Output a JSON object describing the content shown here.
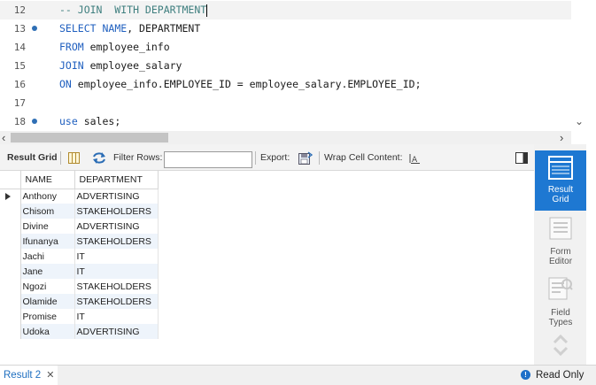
{
  "editor": {
    "lines": [
      {
        "num": "12",
        "marker": false,
        "parts": [
          {
            "t": "-- JOIN  WITH DEPARTMENT",
            "c": "cmt"
          }
        ]
      },
      {
        "num": "13",
        "marker": true,
        "parts": [
          {
            "t": "SELECT",
            "c": "kw"
          },
          {
            "t": " ",
            "c": "txt"
          },
          {
            "t": "NAME",
            "c": "kw"
          },
          {
            "t": ", DEPARTMENT",
            "c": "txt"
          }
        ]
      },
      {
        "num": "14",
        "marker": false,
        "parts": [
          {
            "t": "FROM",
            "c": "kw"
          },
          {
            "t": " employee_info",
            "c": "txt"
          }
        ]
      },
      {
        "num": "15",
        "marker": false,
        "parts": [
          {
            "t": "JOIN",
            "c": "kw"
          },
          {
            "t": " employee_salary",
            "c": "txt"
          }
        ]
      },
      {
        "num": "16",
        "marker": false,
        "parts": [
          {
            "t": "ON",
            "c": "kw"
          },
          {
            "t": " employee_info.EMPLOYEE_ID = employee_salary.EMPLOYEE_ID;",
            "c": "txt"
          }
        ]
      },
      {
        "num": "17",
        "marker": false,
        "parts": []
      },
      {
        "num": "18",
        "marker": true,
        "parts": [
          {
            "t": "use",
            "c": "kw"
          },
          {
            "t": " sales;",
            "c": "txt"
          }
        ]
      }
    ]
  },
  "toolbar": {
    "result_grid": "Result Grid",
    "filter_rows": "Filter Rows:",
    "filter_value": "",
    "export": "Export:",
    "wrap_cell": "Wrap Cell Content:"
  },
  "grid": {
    "columns": [
      "NAME",
      "DEPARTMENT"
    ],
    "rows": [
      [
        "Anthony",
        "ADVERTISING"
      ],
      [
        "Chisom",
        "STAKEHOLDERS"
      ],
      [
        "Divine",
        "ADVERTISING"
      ],
      [
        "Ifunanya",
        "STAKEHOLDERS"
      ],
      [
        "Jachi",
        "IT"
      ],
      [
        "Jane",
        "IT"
      ],
      [
        "Ngozi",
        "STAKEHOLDERS"
      ],
      [
        "Olamide",
        "STAKEHOLDERS"
      ],
      [
        "Promise",
        "IT"
      ],
      [
        "Udoka",
        "ADVERTISING"
      ]
    ]
  },
  "side_panel": {
    "result_grid": [
      "Result",
      "Grid"
    ],
    "form_editor": [
      "Form",
      "Editor"
    ],
    "field_types": [
      "Field",
      "Types"
    ]
  },
  "bottom": {
    "tab_label": "Result 2",
    "status": "Read Only"
  },
  "colors": {
    "keyword": "#1f5fbf",
    "comment": "#3f7f7f",
    "active_panel": "#1e78d2",
    "alt_row": "#eef4fb"
  },
  "icons": [
    "breakpoint-dot-icon",
    "grid-layout-icon",
    "refresh-arrows-icon",
    "export-icon",
    "wrap-text-icon",
    "toggle-panel-icon",
    "result-grid-icon",
    "form-editor-icon",
    "field-types-icon",
    "chevron-icon",
    "info-icon",
    "close-icon",
    "row-pointer-icon"
  ]
}
